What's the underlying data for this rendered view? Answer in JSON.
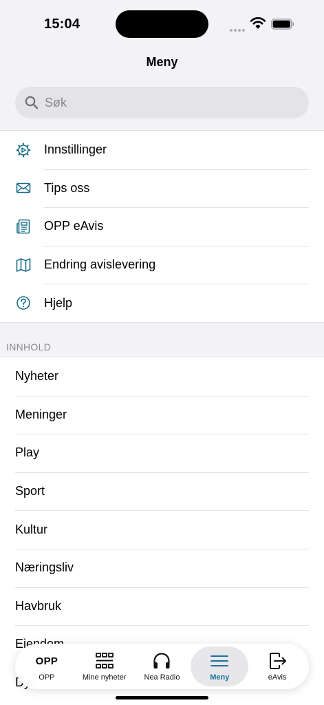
{
  "status_bar": {
    "time": "15:04"
  },
  "nav": {
    "title": "Meny"
  },
  "search": {
    "placeholder": "Søk",
    "value": ""
  },
  "menu_items": [
    {
      "label": "Innstillinger",
      "icon": "settings-icon"
    },
    {
      "label": "Tips oss",
      "icon": "mail-icon"
    },
    {
      "label": "OPP eAvis",
      "icon": "newspaper-icon"
    },
    {
      "label": "Endring avislevering",
      "icon": "map-icon"
    },
    {
      "label": "Hjelp",
      "icon": "help-icon"
    }
  ],
  "content_section": {
    "header": "INNHOLD",
    "items": [
      "Nyheter",
      "Meninger",
      "Play",
      "Sport",
      "Kultur",
      "Næringsliv",
      "Havbruk",
      "Eiendom",
      "Dyr"
    ]
  },
  "tab_bar": {
    "tabs": [
      {
        "label": "OPP",
        "logo_text": "OPP",
        "active": false
      },
      {
        "label": "Mine nyheter",
        "icon": "grid-icon",
        "active": false
      },
      {
        "label": "Nea Radio",
        "icon": "headphones-icon",
        "active": false
      },
      {
        "label": "Meny",
        "icon": "hamburger-menu-icon",
        "active": true
      },
      {
        "label": "eAvis",
        "icon": "exit-icon",
        "active": false
      }
    ]
  },
  "colors": {
    "accent": "#1d6fa0",
    "icon_teal": "#1b6f8a",
    "background": "#f2f2f7",
    "search_bg": "#e3e3e8",
    "secondary_text": "#8a8a8e"
  }
}
